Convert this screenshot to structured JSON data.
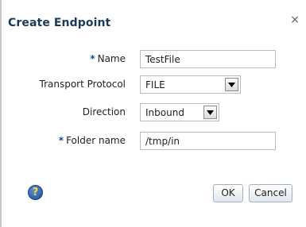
{
  "dialog": {
    "title": "Create Endpoint",
    "close_glyph": "×",
    "close_icon": "close-icon"
  },
  "form": {
    "required_marker": "*",
    "name": {
      "label": "Name",
      "value": "TestFile",
      "required": true
    },
    "transport_protocol": {
      "label": "Transport Protocol",
      "selected": "FILE"
    },
    "direction": {
      "label": "Direction",
      "selected": "Inbound"
    },
    "folder_name": {
      "label": "Folder name",
      "value": "/tmp/in",
      "required": true
    }
  },
  "footer": {
    "help_glyph": "?",
    "help_icon": "help-icon",
    "ok_label": "OK",
    "cancel_label": "Cancel"
  },
  "colors": {
    "title": "#1a3a57",
    "required_marker": "#1a4f85",
    "input_border": "#b6bdc6",
    "button_border": "#9eb0c4"
  }
}
